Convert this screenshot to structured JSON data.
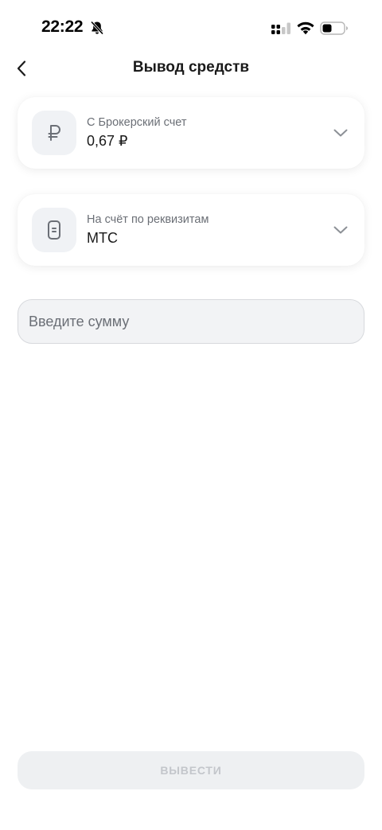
{
  "status_bar": {
    "time": "22:22"
  },
  "header": {
    "title": "Вывод средств"
  },
  "from_account": {
    "label": "С Брокерский счет",
    "value": "0,67 ₽",
    "icon": "ruble-icon"
  },
  "to_account": {
    "label": "На счёт по реквизитам",
    "value": "МТС",
    "icon": "phone-icon"
  },
  "amount": {
    "placeholder": "Введите сумму",
    "value": ""
  },
  "submit": {
    "label": "ВЫВЕСТИ"
  },
  "colors": {
    "icon_bg": "#f0f2f5",
    "input_bg": "#f2f3f5",
    "button_disabled_bg": "#eef0f2",
    "button_disabled_text": "#c3c6cb",
    "muted_text": "#6b6f76"
  }
}
